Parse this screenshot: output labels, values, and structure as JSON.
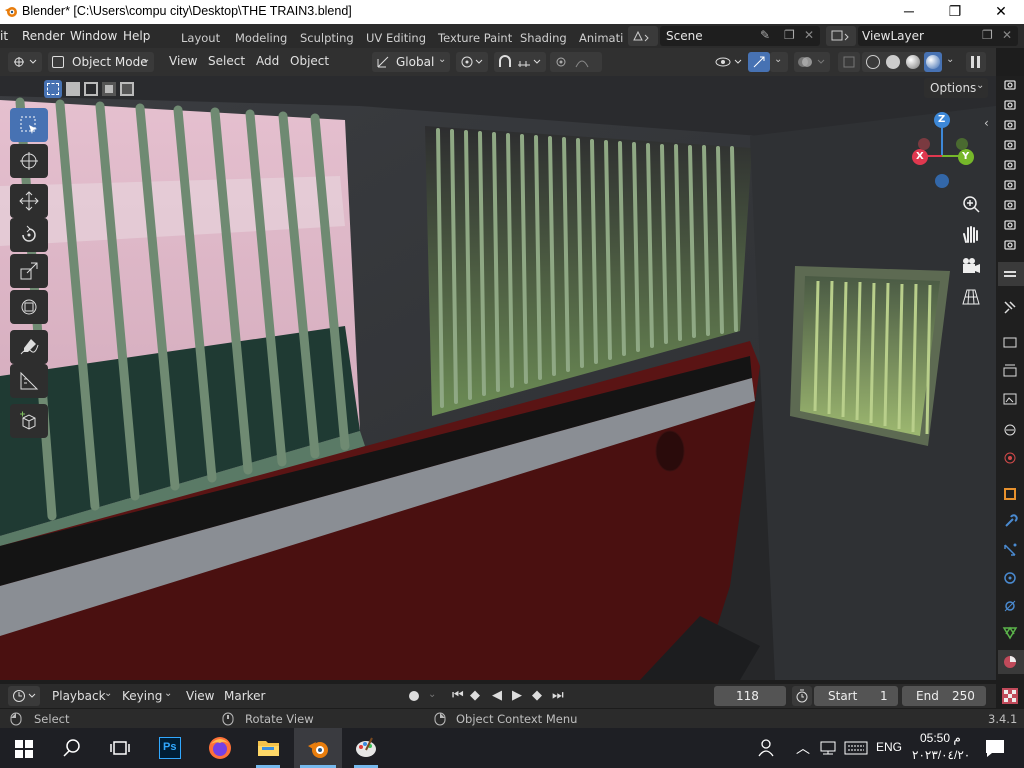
{
  "window": {
    "title": "Blender* [C:\\Users\\compu city\\Desktop\\THE TRAIN3.blend]",
    "minimize": "─",
    "maximize": "❐",
    "close": "✕"
  },
  "menu": {
    "items": [
      "it",
      "Render",
      "Window",
      "Help"
    ],
    "workspaces": [
      "Layout",
      "Modeling",
      "Sculpting",
      "UV Editing",
      "Texture Paint",
      "Shading",
      "Animati"
    ],
    "scene": "Scene",
    "view_layer": "ViewLayer"
  },
  "header": {
    "mode": "Object Mode",
    "menus": [
      "View",
      "Select",
      "Add",
      "Object"
    ],
    "orientation": "Global",
    "options": "Options"
  },
  "viewport": {
    "gizmo": {
      "x": "X",
      "y": "Y",
      "z": "Z"
    },
    "colors": {
      "x": "#e0384f",
      "y": "#76b72a",
      "z": "#3d88d8",
      "active_tool": "#4772b3"
    }
  },
  "timeline": {
    "menus": [
      "Playback",
      "Keying",
      "View",
      "Marker"
    ],
    "current_frame": "118",
    "start_label": "Start",
    "start_value": "1",
    "end_label": "End",
    "end_value": "250"
  },
  "statusbar": {
    "select": "Select",
    "rotate": "Rotate View",
    "context": "Object Context Menu",
    "version": "3.4.1"
  },
  "taskbar": {
    "lang": "ENG",
    "time": "05:50 م",
    "date": "٢٠٢٣/٠٤/٢٠"
  }
}
